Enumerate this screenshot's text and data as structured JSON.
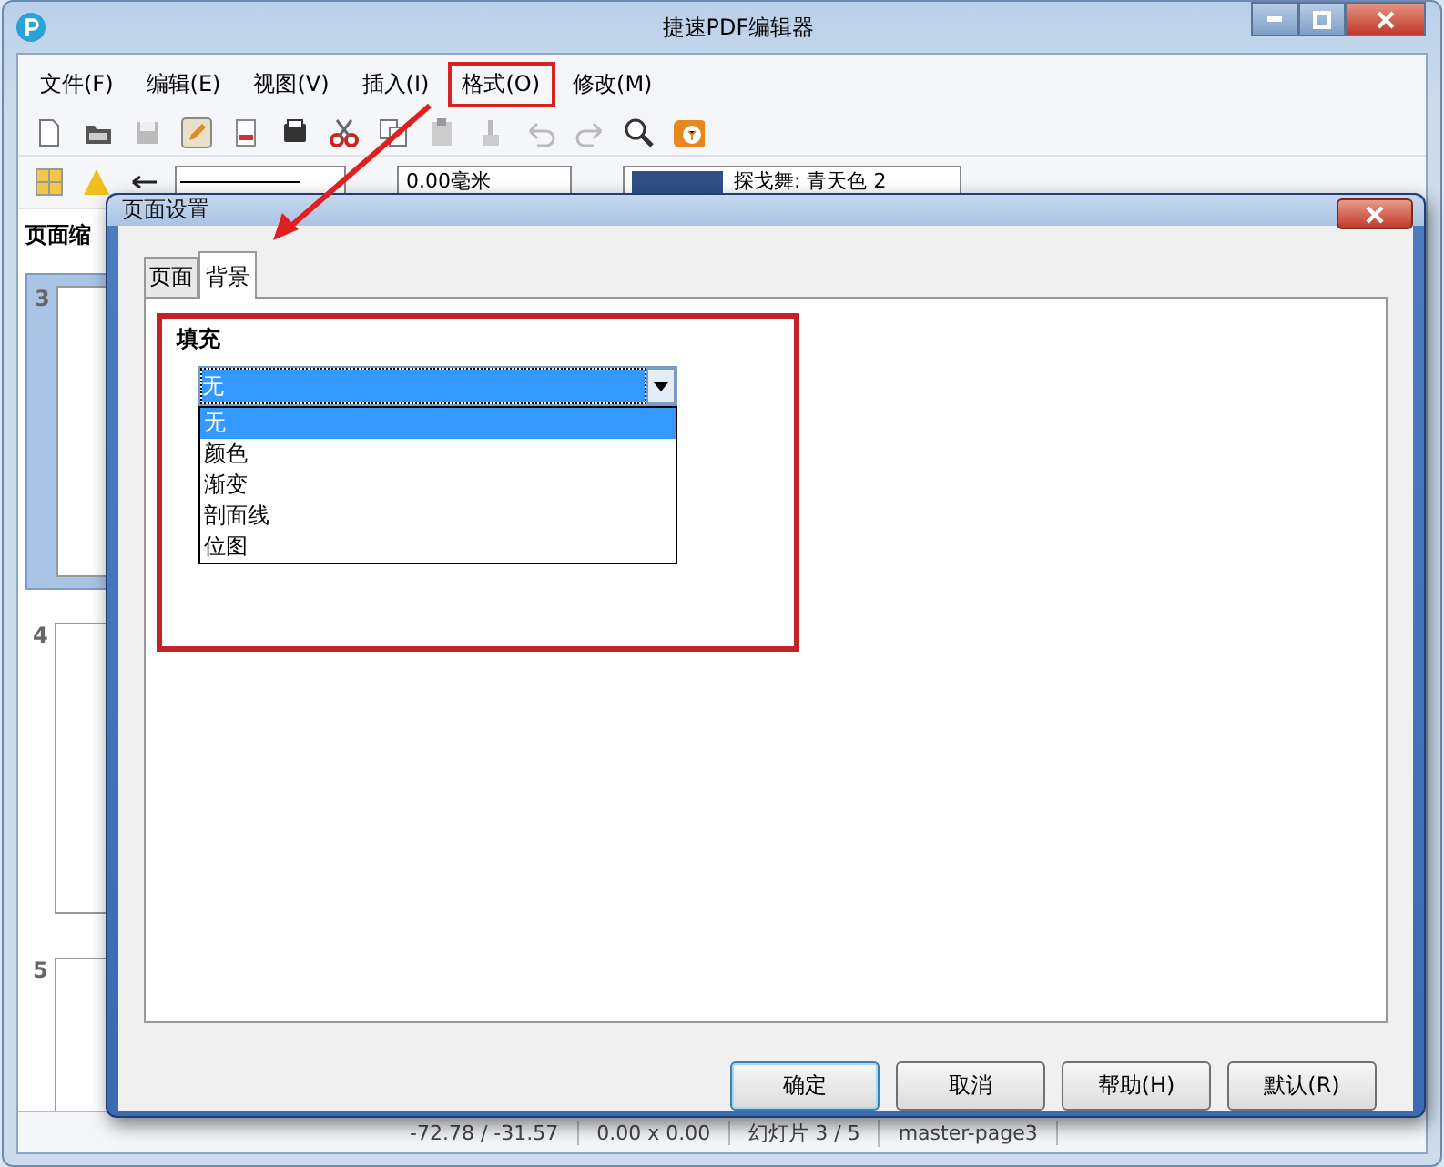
{
  "window": {
    "title": "捷速PDF编辑器"
  },
  "menu": [
    {
      "label": "文件(F)",
      "annotated": false
    },
    {
      "label": "编辑(E)",
      "annotated": false
    },
    {
      "label": "视图(V)",
      "annotated": false
    },
    {
      "label": "插入(I)",
      "annotated": false
    },
    {
      "label": "格式(O)",
      "annotated": true
    },
    {
      "label": "修改(M)",
      "annotated": false
    }
  ],
  "format_bar": {
    "line_width": "0.00毫米",
    "line_color": "探戈舞: 青天色 2"
  },
  "sidebar": {
    "title": "页面缩",
    "pages": [
      {
        "number": "3",
        "selected": true
      },
      {
        "number": "4",
        "selected": false
      },
      {
        "number": "5",
        "selected": false
      }
    ]
  },
  "status_bar": [
    "-72.78 / -31.57",
    "0.00 x 0.00",
    "幻灯片 3 / 5",
    "master-page3"
  ],
  "dialog": {
    "title": "页面设置",
    "tabs": [
      {
        "label": "页面",
        "selected": false
      },
      {
        "label": "背景",
        "selected": true
      }
    ],
    "section": {
      "title": "填充",
      "annotated": true,
      "combo": {
        "value": "无",
        "expanded": true,
        "options": [
          {
            "label": "无",
            "selected": true
          },
          {
            "label": "颜色",
            "selected": false
          },
          {
            "label": "渐变",
            "selected": false
          },
          {
            "label": "剖面线",
            "selected": false
          },
          {
            "label": "位图",
            "selected": false
          }
        ]
      }
    },
    "buttons": [
      {
        "label": "确定",
        "default": true
      },
      {
        "label": "取消",
        "default": false
      },
      {
        "label": "帮助(H)",
        "default": false
      },
      {
        "label": "默认(R)",
        "default": false
      }
    ]
  }
}
